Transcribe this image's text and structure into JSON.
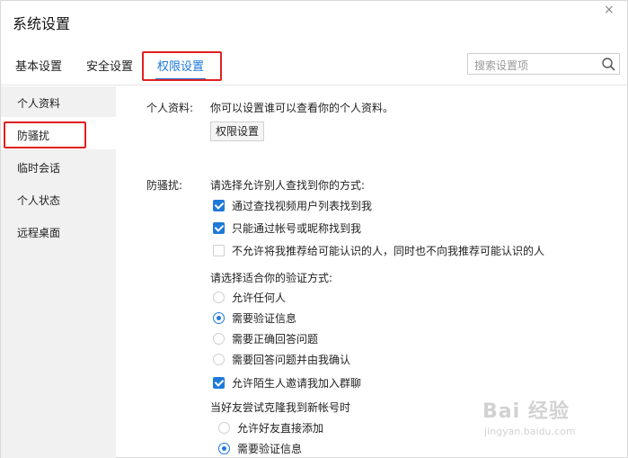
{
  "window": {
    "title": "系统设置",
    "close_glyph": "×"
  },
  "tabs": [
    {
      "label": "基本设置",
      "active": false
    },
    {
      "label": "安全设置",
      "active": false
    },
    {
      "label": "权限设置",
      "active": true
    }
  ],
  "search": {
    "placeholder": "搜索设置项",
    "icon": "search-icon"
  },
  "sidebar": {
    "items": [
      {
        "label": "个人资料",
        "active": false
      },
      {
        "label": "防骚扰",
        "active": true
      },
      {
        "label": "临时会话",
        "active": false
      },
      {
        "label": "个人状态",
        "active": false
      },
      {
        "label": "远程桌面",
        "active": false
      }
    ]
  },
  "profile": {
    "label": "个人资料:",
    "description": "你可以设置谁可以查看你的个人资料。",
    "button": "权限设置"
  },
  "harass": {
    "label": "防骚扰:",
    "find_title": "请选择允许别人查找到你的方式:",
    "find_options": [
      {
        "label": "通过查找视频用户列表找到我",
        "checked": true
      },
      {
        "label": "只能通过帐号或昵称找到我",
        "checked": true
      },
      {
        "label": "不允许将我推荐给可能认识的人，同时也不向我推荐可能认识的人",
        "checked": false
      }
    ],
    "verify_title": "请选择适合你的验证方式:",
    "verify_options": [
      {
        "label": "允许任何人",
        "selected": false
      },
      {
        "label": "需要验证信息",
        "selected": true
      },
      {
        "label": "需要正确回答问题",
        "selected": false
      },
      {
        "label": "需要回答问题并由我确认",
        "selected": false
      }
    ],
    "group_invite": {
      "label": "允许陌生人邀请我加入群聊",
      "checked": true
    },
    "clone_title": "当好友尝试克隆我到新帐号时",
    "clone_options": [
      {
        "label": "允许好友直接添加",
        "selected": false
      },
      {
        "label": "需要验证信息",
        "selected": true
      }
    ]
  },
  "watermark": {
    "main": "Bai 经验",
    "sub": "jingyan.baidu.com"
  },
  "colors": {
    "accent": "#1e7ad9",
    "highlight_border": "#e02020",
    "sidebar_bg": "#f1f1f1"
  }
}
